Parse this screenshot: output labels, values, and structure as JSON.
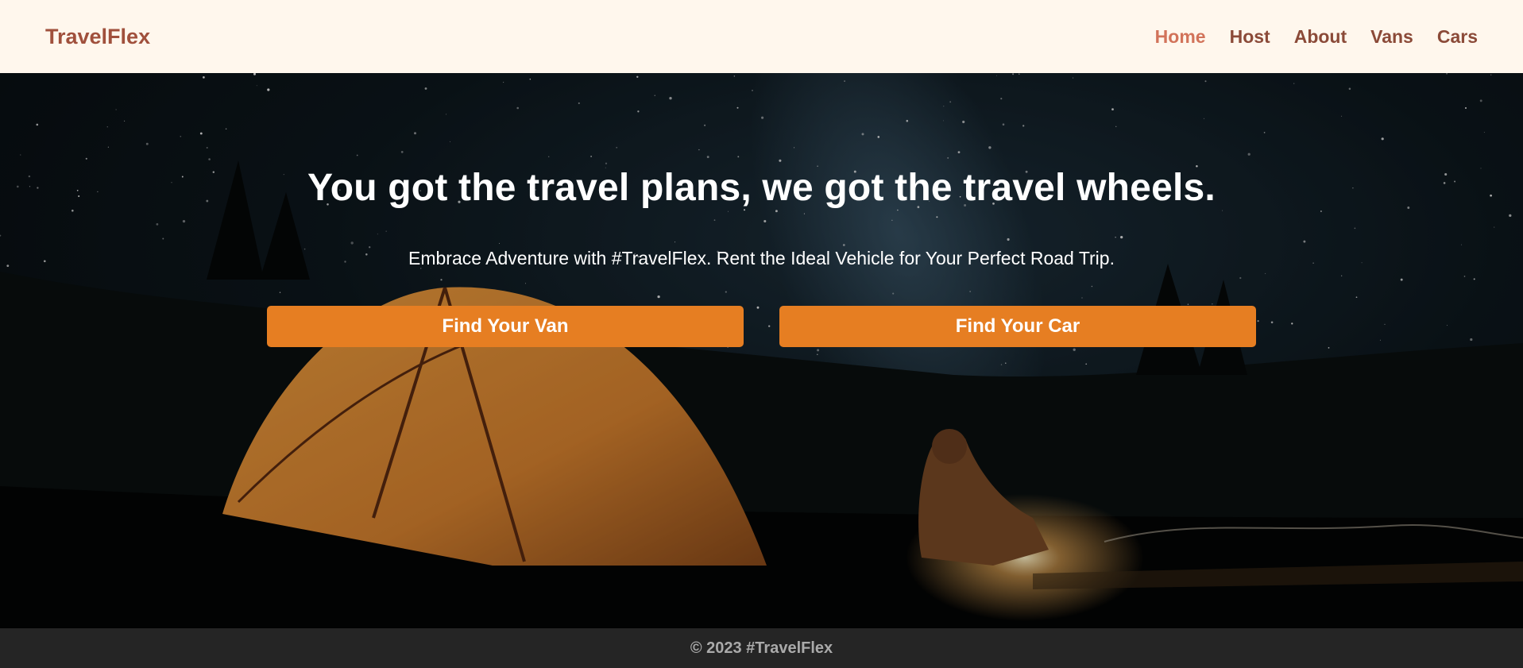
{
  "header": {
    "brand": "TravelFlex",
    "nav": [
      {
        "label": "Home",
        "active": true
      },
      {
        "label": "Host",
        "active": false
      },
      {
        "label": "About",
        "active": false
      },
      {
        "label": "Vans",
        "active": false
      },
      {
        "label": "Cars",
        "active": false
      }
    ]
  },
  "hero": {
    "title": "You got the travel plans, we got the travel wheels.",
    "subtitle": "Embrace Adventure with #TravelFlex. Rent the Ideal Vehicle for Your Perfect Road Trip.",
    "buttons": {
      "van": "Find Your Van",
      "car": "Find Your Car"
    },
    "background_image": "night-camping-tent-stars-icon"
  },
  "footer": {
    "text": "© 2023 #TravelFlex"
  },
  "colors": {
    "header_bg": "#FFF7ED",
    "brand": "#A0503C",
    "nav_text": "#8B4A38",
    "nav_active": "#D2735A",
    "cta_bg": "#E67E22",
    "footer_bg": "#252525"
  }
}
